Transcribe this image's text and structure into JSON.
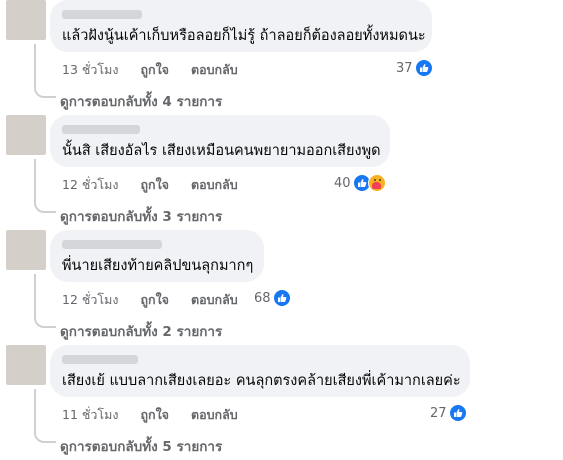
{
  "comments": [
    {
      "text": "แล้วฝังนู้นเค้าเก็บหรือลอยก็ไม่รู้ ถ้าลอยก็ต้องลอยทั้งหมดนะ",
      "time": "13 ชั่วโมง",
      "like_label": "ถูกใจ",
      "reply_label": "ตอบกลับ",
      "reaction_count": "37",
      "reactions": [
        "like-icon"
      ],
      "view_replies": "ดูการตอบกลับทั้ง 4 รายการ"
    },
    {
      "text": "นั้นสิ เสียงอัลไร เสียงเหมือนคนพยายามออกเสียงพูด",
      "time": "12 ชั่วโมง",
      "like_label": "ถูกใจ",
      "reply_label": "ตอบกลับ",
      "reaction_count": "40",
      "reactions": [
        "like-icon",
        "care-icon"
      ],
      "view_replies": "ดูการตอบกลับทั้ง 3 รายการ"
    },
    {
      "text": "พี่นายเสียงท้ายคลิปขนลุกมากๆ",
      "time": "12 ชั่วโมง",
      "like_label": "ถูกใจ",
      "reply_label": "ตอบกลับ",
      "reaction_count": "68",
      "reactions": [
        "like-icon"
      ],
      "view_replies": "ดูการตอบกลับทั้ง 2 รายการ"
    },
    {
      "text": "เสียงเย้ แบบลากเสียงเลยอะ คนลุกตรงคล้ายเสียงพี่เค้ามากเลยค่ะ",
      "time": "11 ชั่วโมง",
      "like_label": "ถูกใจ",
      "reply_label": "ตอบกลับ",
      "reaction_count": "27",
      "reactions": [
        "like-icon"
      ],
      "view_replies": "ดูการตอบกลับทั้ง 5 รายการ"
    }
  ],
  "colors": {
    "bubble": "#f0f2f5",
    "meta_text": "#65676b",
    "like_blue": "#1877f2",
    "thread_line": "#ced0d4"
  }
}
